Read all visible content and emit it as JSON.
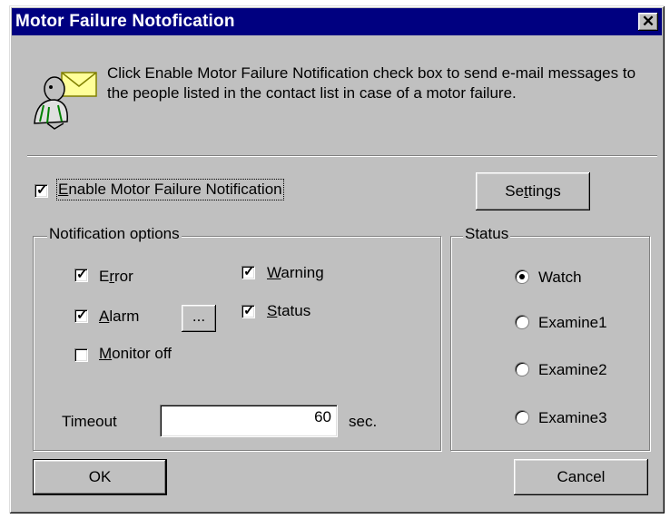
{
  "window": {
    "title": "Motor Failure Notofication",
    "close_label": "✕"
  },
  "header": {
    "icon": "mail-person-icon",
    "message": "Click Enable Motor Failure Notification check box to send e-mail messages to the people listed in the contact list in case of a motor failure."
  },
  "enable": {
    "label_pre": "",
    "accel": "E",
    "label_post": "nable Motor Failure Notification",
    "checked": true
  },
  "settings_button": {
    "pre": "Se",
    "accel": "t",
    "post": "tings"
  },
  "notification": {
    "legend": "Notification options",
    "error": {
      "pre": "E",
      "accel": "r",
      "post": "ror",
      "checked": true
    },
    "warning": {
      "pre": "",
      "accel": "W",
      "post": "arning",
      "checked": true
    },
    "alarm": {
      "pre": "",
      "accel": "A",
      "post": "larm",
      "checked": true
    },
    "alarm_more_button": "...",
    "status": {
      "pre": "",
      "accel": "S",
      "post": "tatus",
      "checked": true
    },
    "monitor_off": {
      "pre": "",
      "accel": "M",
      "post": "onitor off",
      "checked": false
    },
    "timeout_label": "Timeout",
    "timeout_value": "60",
    "timeout_unit": "sec."
  },
  "status": {
    "legend": "Status",
    "options": [
      "Watch",
      "Examine1",
      "Examine2",
      "Examine3"
    ],
    "selected": "Watch"
  },
  "footer": {
    "ok_label": "OK",
    "cancel_label": "Cancel"
  },
  "colors": {
    "titlebar": "#000080",
    "face": "#c0c0c0"
  }
}
